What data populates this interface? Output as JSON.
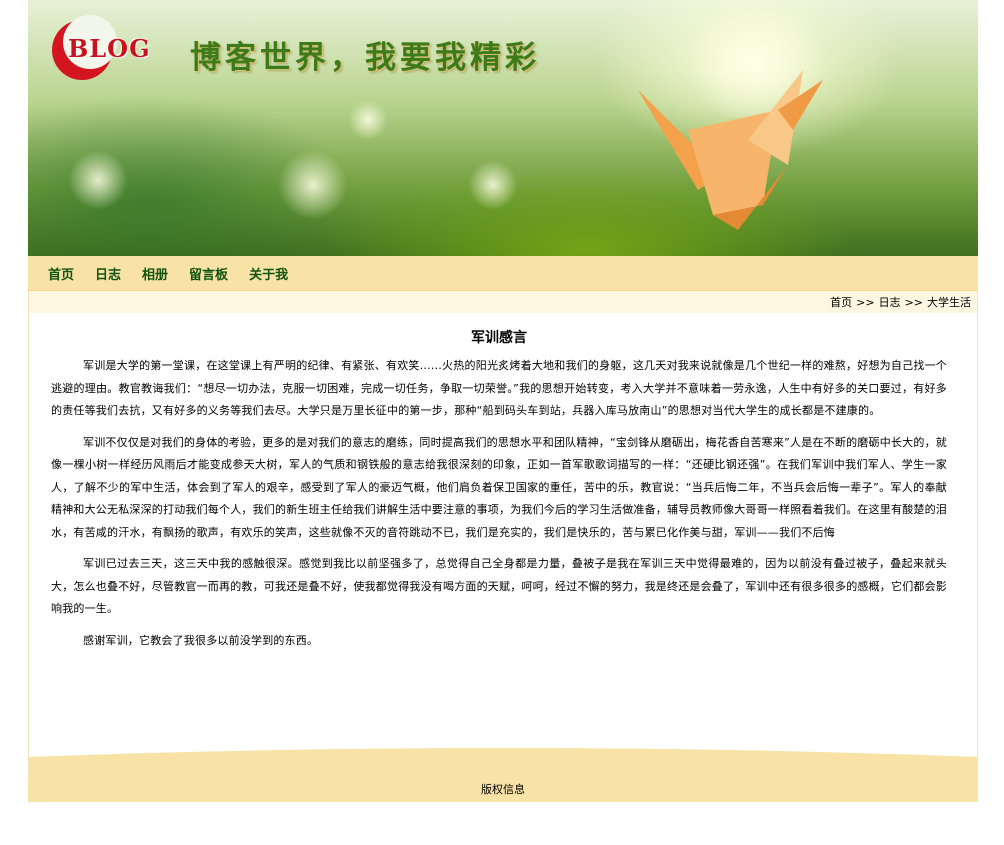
{
  "header": {
    "logo_text": "BLOG",
    "slogan": "博客世界，我要我精彩"
  },
  "nav": {
    "items": [
      {
        "label": "首页"
      },
      {
        "label": "日志"
      },
      {
        "label": "相册"
      },
      {
        "label": "留言板"
      },
      {
        "label": "关于我"
      }
    ]
  },
  "breadcrumb": {
    "home": "首页",
    "sep1": ">>",
    "section": "日志",
    "sep2": ">>",
    "current": "大学生活"
  },
  "article": {
    "title": "军训感言",
    "paragraphs": [
      "军训是大学的第一堂课，在这堂课上有严明的纪律、有紧张、有欢笑……火热的阳光炙烤着大地和我们的身躯，这几天对我来说就像是几个世纪一样的难熬，好想为自己找一个逃避的理由。教官教诲我们：“想尽一切办法，克服一切困难，完成一切任务，争取一切荣誉。”我的思想开始转变，考入大学并不意味着一劳永逸，人生中有好多的关口要过，有好多的责任等我们去抗，又有好多的义务等我们去尽。大学只是万里长征中的第一步，那种“船到码头车到站，兵器入库马放南山”的思想对当代大学生的成长都是不建康的。",
      "军训不仅仅是对我们的身体的考验，更多的是对我们的意志的磨练，同时提高我们的思想水平和团队精神，“宝剑锋从磨砺出，梅花香自苦寒来”人是在不断的磨砺中长大的，就像一棵小树一样经历风雨后才能变成参天大树，军人的气质和钢铁般的意志给我很深刻的印象，正如一首军歌歌词描写的一样：“还硬比钢还强”。在我们军训中我们军人、学生一家人，了解不少的军中生活，体会到了军人的艰辛，感受到了军人的豪迈气概，他们肩负着保卫国家的重任，苦中的乐，教官说：“当兵后悔二年，不当兵会后悔一辈子”。军人的奉献精神和大公无私深深的打动我们每个人，我们的新生班主任给我们讲解生活中要注意的事项，为我们今后的学习生活做准备，辅导员教师像大哥哥一样照看着我们。在这里有酸楚的泪水，有苦咸的汗水，有飘扬的歌声，有欢乐的笑声，这些就像不灭的音符跳动不已，我们是充实的，我们是快乐的，苦与累已化作美与甜，军训——我们不后悔",
      "军训已过去三天，这三天中我的感触很深。感觉到我比以前坚强多了，总觉得自己全身都是力量，叠被子是我在军训三天中觉得最难的，因为以前没有叠过被子，叠起来就头大，怎么也叠不好，尽管教官一而再的教，可我还是叠不好，使我都觉得我没有喝方面的天赋，呵呵，经过不懈的努力，我是终还是会叠了，军训中还有很多很多的感概，它们都会影响我的一生。",
      "感谢军训，它教会了我很多以前没学到的东西。"
    ]
  },
  "footer": {
    "copyright": "版权信息"
  }
}
